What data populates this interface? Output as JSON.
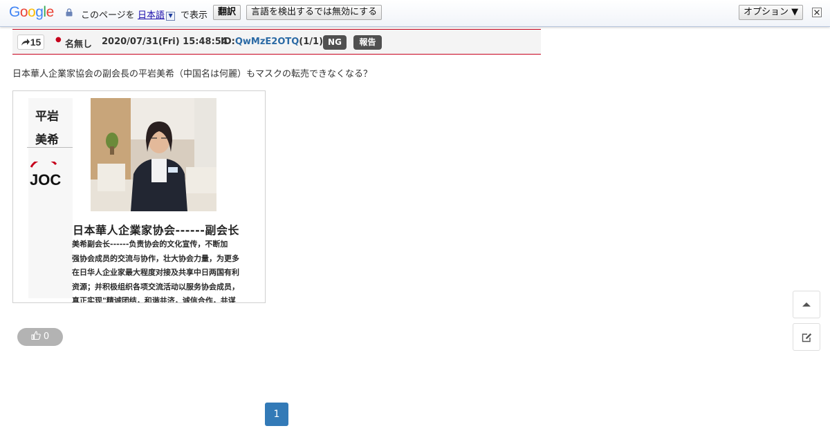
{
  "translate_bar": {
    "logo": "Google",
    "prefix": "このページを",
    "language": "日本語",
    "suffix": "で表示",
    "translate_label": "翻訳",
    "disable_label": "言語を検出するでは無効にする",
    "options_label": "オプション ▼"
  },
  "post": {
    "number": "15",
    "name": "名無し",
    "date": "2020/07/31(Fri) 15:48:54",
    "id_prefix": "ID:",
    "id": "QwMzE2OTQ",
    "id_count": "(1/1)",
    "ng_label": "NG",
    "report_label": "報告",
    "text": "日本華人企業家協会の副会長の平岩美希（中国名は何麗）もマスクの転売できなくなる？"
  },
  "image": {
    "side_name_1": "平岩",
    "side_name_2": "美希",
    "logo_text": "JOC",
    "title": "日本華人企業家协会------副会长",
    "desc_lines": [
      "美希副会长------负责协会的文化宣传，不断加",
      "强协会成员的交流与协作，壮大协会力量，为更多",
      "在日华人企业家最大程度对接及共享中日两国有利",
      "资源；并积极组织各项交流活动以服务协会成员，",
      "真正实现\"精诚团结，和谐共济，诚信合作，共谋"
    ]
  },
  "like": {
    "count": "0"
  },
  "pagination": {
    "current": "1"
  },
  "colors": {
    "accent_red": "#c6001c",
    "id_blue": "#2b6aa5",
    "page_blue": "#337ab7"
  }
}
